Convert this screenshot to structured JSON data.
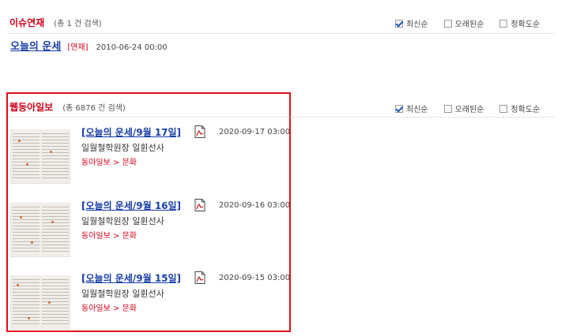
{
  "section1": {
    "title": "이슈연재",
    "count": "(총 1 건 검색)",
    "sort_options": [
      {
        "label": "최신순",
        "checked": true
      },
      {
        "label": "오래된순",
        "checked": false
      },
      {
        "label": "정확도순",
        "checked": false
      }
    ],
    "item": {
      "title": "오늘의 운세",
      "tag": "[연재]",
      "date": "2010-06-24 00:00"
    }
  },
  "section2": {
    "title": "웹동아일보",
    "count": "(총 6876 건 검색)",
    "sort_options": [
      {
        "label": "최신순",
        "checked": true
      },
      {
        "label": "오래된순",
        "checked": false
      },
      {
        "label": "정확도순",
        "checked": false
      }
    ],
    "articles": [
      {
        "title": "[오늘의 운세/9월 17일]",
        "date": "2020-09-17 03:00",
        "author": "일월철학원장 일휜선사",
        "source": "동아일보",
        "separator": ">",
        "category": "문화"
      },
      {
        "title": "[오늘의 운세/9월 16일]",
        "date": "2020-09-16 03:00",
        "author": "일월철학원장 일휜선사",
        "source": "동아일보",
        "separator": ">",
        "category": "문화"
      },
      {
        "title": "[오늘의 운세/9월 15일]",
        "date": "2020-09-15 03:00",
        "author": "일월철학원장 일휜선사",
        "source": "동아일보",
        "separator": ">",
        "category": "문화"
      }
    ]
  },
  "colors": {
    "accent_red": "#d0021b",
    "link_blue": "#1a3fa8",
    "highlight_box": "#e0101a"
  },
  "icons": [
    "checkbox-icon",
    "pdf-icon",
    "newspaper-thumbnail"
  ]
}
